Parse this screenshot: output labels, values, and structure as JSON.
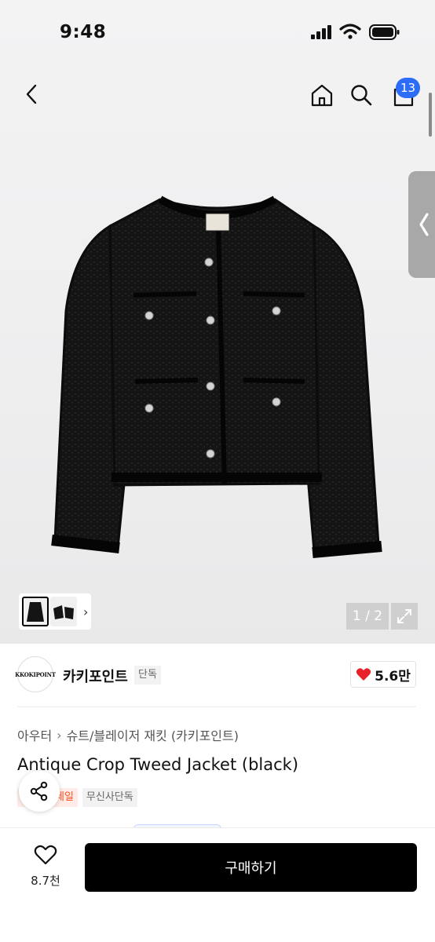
{
  "status_bar": {
    "time": "9:48"
  },
  "header": {
    "cart_count": "13"
  },
  "gallery": {
    "pager": "1 / 2",
    "thumb_more": "›"
  },
  "brand": {
    "logo_text": "KKOKIPOINT",
    "name": "카키포인트",
    "tag": "단독",
    "likes": "5.6만"
  },
  "breadcrumb": {
    "level1": "아우터",
    "level2": "슈트/블레이저 재킷 (카키포인트)"
  },
  "product": {
    "title": "Antique Crop Tweed Jacket (black)",
    "tags": [
      "세일",
      "무신사단독"
    ]
  },
  "bottom_bar": {
    "wish_count": "8.7천",
    "buy_label": "구매하기"
  },
  "colors": {
    "accent_blue": "#2d6cf6",
    "heart_red": "#e8202a",
    "sale_orange": "#ff4f1f"
  }
}
